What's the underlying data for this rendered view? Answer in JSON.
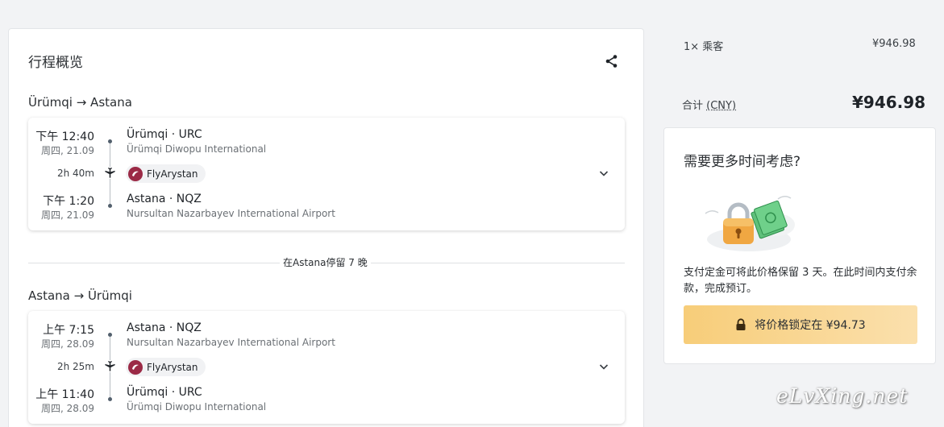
{
  "itinerary": {
    "title": "行程概览",
    "segments": [
      {
        "route": "Ürümqi → Astana",
        "departure": {
          "time": "下午 12:40",
          "date": "周四, 21.09",
          "code": "Ürümqi · URC",
          "name": "Ürümqi Diwopu International"
        },
        "duration": "2h 40m",
        "airline": "FlyArystan",
        "arrival": {
          "time": "下午 1:20",
          "date": "周四, 21.09",
          "code": "Astana · NQZ",
          "name": "Nursultan Nazarbayev International Airport"
        }
      },
      {
        "route": "Astana → Ürümqi",
        "departure": {
          "time": "上午 7:15",
          "date": "周四, 28.09",
          "code": "Astana · NQZ",
          "name": "Nursultan Nazarbayev International Airport"
        },
        "duration": "2h 25m",
        "airline": "FlyArystan",
        "arrival": {
          "time": "上午 11:40",
          "date": "周四, 28.09",
          "code": "Ürümqi · URC",
          "name": "Ürümqi Diwopu International"
        }
      }
    ],
    "stopover": "在Astana停留 7 晚"
  },
  "price": {
    "passengers_label": "1× 乘客",
    "passengers_price": "¥946.98",
    "total_label": "合计",
    "total_currency": "(CNY)",
    "total_price": "¥946.98"
  },
  "hold": {
    "title": "需要更多时间考虑?",
    "description": "支付定金可将此价格保留 3 天。在此时间内支付余款，完成预订。",
    "button_label": "将价格锁定在 ¥94.73"
  },
  "watermark": "eLvXing.net",
  "colors": {
    "accent": "#f7cd79",
    "airline_brand": "#9b2a46"
  },
  "icons": {
    "share": "share-icon",
    "plane": "plane-icon",
    "chevron": "chevron-down-icon",
    "lock": "lock-icon"
  }
}
